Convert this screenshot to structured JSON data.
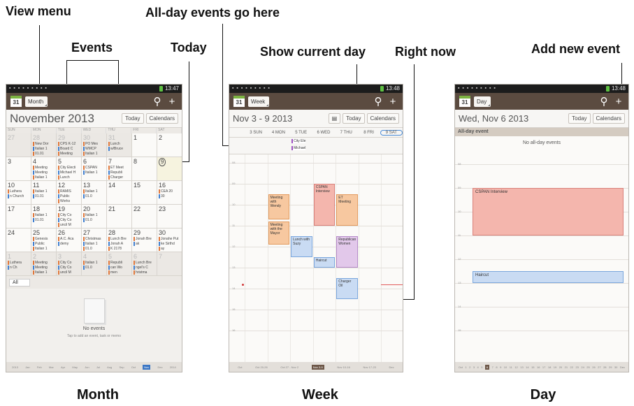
{
  "annotations": {
    "view_menu": "View menu",
    "all_day_events": "All-day events go here",
    "events": "Events",
    "today": "Today",
    "show_current_day": "Show current day",
    "right_now": "Right now",
    "add_new_event": "Add new event"
  },
  "captions": {
    "month": "Month",
    "week": "Week",
    "day": "Day"
  },
  "status": {
    "time_month": "13:47",
    "time_week": "13:48",
    "time_day": "13:48"
  },
  "month": {
    "cal_icon": "31",
    "view_label": "Month",
    "title": "November 2013",
    "today_btn": "Today",
    "calendars_btn": "Calendars",
    "dow": [
      "SUN",
      "MON",
      "TUE",
      "WED",
      "THU",
      "FRI",
      "SAT"
    ],
    "weeks": [
      [
        {
          "d": "27",
          "dim": true,
          "ev": []
        },
        {
          "d": "28",
          "dim": true,
          "ev": [
            "New Dor",
            "Italian 1",
            "01.01"
          ]
        },
        {
          "d": "29",
          "dim": true,
          "ev": [
            "CPS K-12",
            "Board C",
            "Meeting"
          ]
        },
        {
          "d": "30",
          "dim": true,
          "ev": [
            "PO Mes",
            "WMCP",
            "Italian 1"
          ]
        },
        {
          "d": "31",
          "dim": true,
          "ev": [
            "Lunch",
            "w/Bruce"
          ]
        },
        {
          "d": "1",
          "ev": []
        },
        {
          "d": "2",
          "ev": []
        }
      ],
      [
        {
          "d": "3",
          "ev": []
        },
        {
          "d": "4",
          "ev": [
            "Meeting",
            "Meeting",
            "Italian 1"
          ]
        },
        {
          "d": "5",
          "ev": [
            "City Electi",
            "Michael H",
            "Lunch"
          ]
        },
        {
          "d": "6",
          "ev": [
            "CSPAN",
            "Italian 1"
          ]
        },
        {
          "d": "7",
          "ev": [
            "ET Meet",
            "Republi",
            "Charger"
          ]
        },
        {
          "d": "8",
          "ev": []
        },
        {
          "d": "9",
          "today": true,
          "ev": []
        }
      ],
      [
        {
          "d": "10",
          "ev": [
            "Luthera",
            "n Church"
          ]
        },
        {
          "d": "11",
          "ev": [
            "Italian 1",
            "01.01"
          ]
        },
        {
          "d": "12",
          "ev": [
            "RAMIS",
            "Public",
            "Works"
          ]
        },
        {
          "d": "13",
          "ev": [
            "Italian 1",
            "01.0"
          ]
        },
        {
          "d": "14",
          "ev": []
        },
        {
          "d": "15",
          "ev": []
        },
        {
          "d": "16",
          "ev": [
            "CEA 20",
            "30"
          ]
        }
      ],
      [
        {
          "d": "17",
          "ev": []
        },
        {
          "d": "18",
          "ev": [
            "Italian 1",
            "01.01"
          ]
        },
        {
          "d": "19",
          "ev": [
            "City Co",
            "City Co",
            "uncil M"
          ]
        },
        {
          "d": "20",
          "ev": [
            "Italian 1",
            "01.0"
          ]
        },
        {
          "d": "21",
          "ev": []
        },
        {
          "d": "22",
          "ev": []
        },
        {
          "d": "23",
          "ev": []
        }
      ],
      [
        {
          "d": "24",
          "ev": []
        },
        {
          "d": "25",
          "ev": [
            "Genesis",
            "Public",
            "Italian 1"
          ]
        },
        {
          "d": "26",
          "ev": [
            "A.C. Aca",
            "demy"
          ]
        },
        {
          "d": "27",
          "ev": [
            "Christmas",
            "Italian 1",
            "01.0"
          ]
        },
        {
          "d": "28",
          "ev": [
            "Lunch Bre",
            "Jonah A",
            "K 2178"
          ]
        },
        {
          "d": "29",
          "ev": [
            "Jonah Bre",
            "ak"
          ]
        },
        {
          "d": "30",
          "ev": [
            "Jonahe Put",
            "ke Sirthd",
            "ay"
          ]
        }
      ],
      [
        {
          "d": "1",
          "dim": true,
          "ev": [
            "Luthera",
            "n Ch"
          ]
        },
        {
          "d": "2",
          "dim": true,
          "ev": [
            "Meeting",
            "Meeting",
            "Italian 1"
          ]
        },
        {
          "d": "3",
          "dim": true,
          "ev": [
            "City Co",
            "City Co",
            "uncil M"
          ]
        },
        {
          "d": "4",
          "dim": true,
          "ev": [
            "Italian 1",
            "01.0"
          ]
        },
        {
          "d": "5",
          "dim": true,
          "ev": [
            "Republi",
            "can Wo",
            "men"
          ]
        },
        {
          "d": "6",
          "dim": true,
          "ev": [
            "Lunch Bre",
            "ngel's C",
            "hristma"
          ]
        },
        {
          "d": "7",
          "dim": true,
          "ev": []
        }
      ]
    ],
    "filter": "All",
    "no_events_title": "No events",
    "no_events_hint": "Tap to add an event, task or memo",
    "strip": [
      "2013",
      "Jan",
      "Feb",
      "Mar",
      "Apr",
      "May",
      "Jun",
      "Jul",
      "Aug",
      "Sep",
      "Oct",
      "Nov",
      "Dec",
      "2014"
    ],
    "strip_selected": "Nov"
  },
  "week": {
    "cal_icon": "31",
    "view_label": "Week",
    "title": "Nov 3 - 9 2013",
    "today_btn": "Today",
    "calendars_btn": "Calendars",
    "days": [
      "3 SUN",
      "4 MON",
      "5 TUE",
      "6 WED",
      "7 THU",
      "8 FRI",
      "9 SAT"
    ],
    "allday": [
      "City Ele",
      "Michael"
    ],
    "hours": [
      "08",
      "09",
      "10",
      "11",
      "12",
      "13",
      "14",
      "15",
      "16"
    ],
    "events": [
      {
        "day": 1,
        "start": 9.5,
        "end": 10.7,
        "label": "Meeting with Wendy",
        "color": "orange"
      },
      {
        "day": 1,
        "start": 10.8,
        "end": 11.9,
        "label": "Meeting with the Mayor",
        "color": "orange"
      },
      {
        "day": 3,
        "start": 9.0,
        "end": 11.0,
        "label": "CSPAN Interview",
        "color": "red"
      },
      {
        "day": 4,
        "start": 9.5,
        "end": 11.0,
        "label": "ET Meeting",
        "color": "orange"
      },
      {
        "day": 2,
        "start": 11.5,
        "end": 12.5,
        "label": "Lunch with Suzy",
        "color": "blue"
      },
      {
        "day": 4,
        "start": 11.5,
        "end": 13.0,
        "label": "Republican Women",
        "color": "purple"
      },
      {
        "day": 3,
        "start": 12.5,
        "end": 13.0,
        "label": "Haircut",
        "color": "blue"
      },
      {
        "day": 4,
        "start": 13.5,
        "end": 14.5,
        "label": "Charger Oil",
        "color": "blue"
      }
    ],
    "now_hour": 13.8,
    "strip": [
      "Oct",
      "Oct 20-26",
      "Oct 27 - Nov 2",
      "Nov 3-9",
      "Nov 10-16",
      "Nov 17-23",
      "Dec"
    ],
    "strip_selected": "Nov 3-9"
  },
  "day": {
    "cal_icon": "31",
    "view_label": "Day",
    "title": "Wed, Nov 6 2013",
    "today_btn": "Today",
    "calendars_btn": "Calendars",
    "allday_header": "All-day event",
    "allday_empty": "No all-day events",
    "hours": [
      "08",
      "09",
      "10",
      "11",
      "12",
      "13",
      "14",
      "15"
    ],
    "events": [
      {
        "start": 9.0,
        "end": 11.0,
        "label": "CSPAN Interview",
        "color": "red"
      },
      {
        "start": 12.5,
        "end": 13.0,
        "label": "Haircut",
        "color": "blue"
      }
    ],
    "strip": [
      "Oct",
      "1",
      "2",
      "3",
      "4",
      "5",
      "6",
      "7",
      "8",
      "9",
      "10",
      "11",
      "12",
      "13",
      "14",
      "15",
      "16",
      "17",
      "18",
      "19",
      "20",
      "21",
      "22",
      "23",
      "24",
      "25",
      "26",
      "27",
      "28",
      "29",
      "30",
      "Dec"
    ],
    "strip_selected": "6"
  },
  "colors": {
    "actionbar": "#5b4b40",
    "accent_blue": "#3a76c4",
    "now_red": "#e25c5c"
  }
}
